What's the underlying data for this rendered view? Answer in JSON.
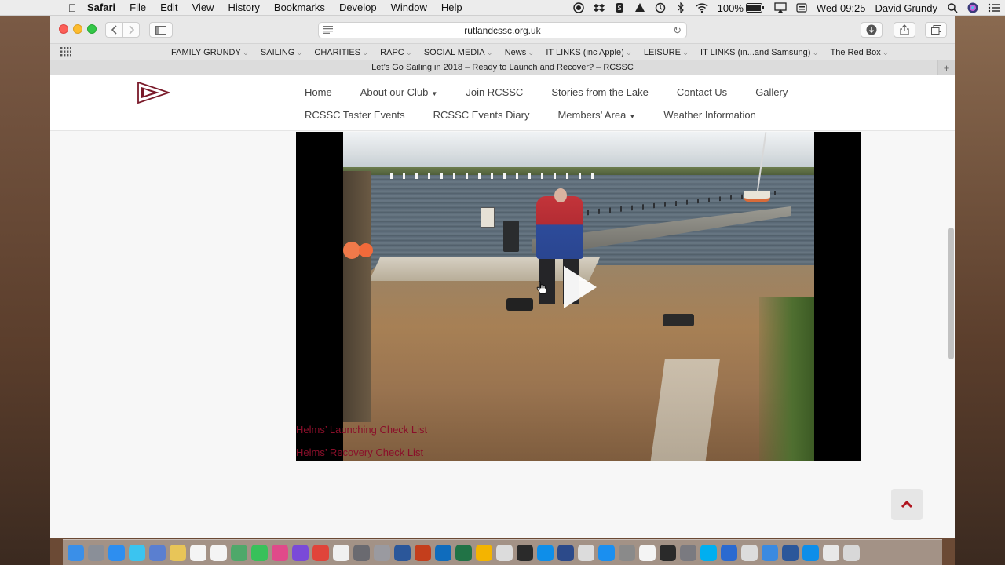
{
  "menubar": {
    "app_name": "Safari",
    "menus": [
      "File",
      "Edit",
      "View",
      "History",
      "Bookmarks",
      "Develop",
      "Window",
      "Help"
    ],
    "battery": "100%",
    "clock": "Wed 09:25",
    "user": "David Grundy"
  },
  "toolbar": {
    "url": "rutlandcssc.org.uk"
  },
  "favorites": [
    {
      "label": "FAMILY GRUNDY"
    },
    {
      "label": "SAILING"
    },
    {
      "label": "CHARITIES"
    },
    {
      "label": "RAPC"
    },
    {
      "label": "SOCIAL MEDIA"
    },
    {
      "label": "News"
    },
    {
      "label": "IT LINKS (inc Apple)"
    },
    {
      "label": "LEISURE"
    },
    {
      "label": "IT LINKS (in...and Samsung)"
    },
    {
      "label": "The Red Box"
    }
  ],
  "tab": {
    "title": "Let’s Go Sailing in 2018 – Ready to Launch and Recover? – RCSSC"
  },
  "site_nav": {
    "row1": [
      {
        "label": "Home",
        "dropdown": false
      },
      {
        "label": "About our Club",
        "dropdown": true
      },
      {
        "label": "Join RCSSC",
        "dropdown": false
      },
      {
        "label": "Stories from the Lake",
        "dropdown": false
      },
      {
        "label": "Contact Us",
        "dropdown": false
      },
      {
        "label": "Gallery",
        "dropdown": false
      }
    ],
    "row2": [
      {
        "label": "RCSSC Taster Events",
        "dropdown": false
      },
      {
        "label": "RCSSC Events Diary",
        "dropdown": false
      },
      {
        "label": "Members’ Area",
        "dropdown": true
      },
      {
        "label": "Weather Information",
        "dropdown": false
      }
    ]
  },
  "content": {
    "links": [
      "Helms’ Launching Check List",
      "Helms’ Recovery Check List"
    ]
  },
  "colors": {
    "link": "#8a0f2a",
    "to_top_arrow": "#b0151f"
  },
  "dock": {
    "icons": [
      "finder-icon",
      "launchpad-icon",
      "safari-icon",
      "ios-app-icon",
      "preview-icon",
      "notes-icon",
      "calendar-icon",
      "reminders-icon",
      "maps-icon",
      "messages-icon",
      "itunes-icon",
      "imovie-icon",
      "chrome-icon",
      "photos-icon",
      "image-capture-icon",
      "system-prefs-icon",
      "word-icon",
      "powerpoint-icon",
      "outlook-icon",
      "excel-icon",
      "google-drive-icon",
      "help-icon",
      "quicktime-icon",
      "teamviewer-icon",
      "malwarebytes-icon",
      "question-icon",
      "app-store-icon",
      "automator-icon",
      "textedit-icon",
      "mosaic-icon",
      "disk-utility-icon",
      "skype-icon",
      "wifi-icon",
      "help2-icon",
      "network-icon",
      "word-alt-icon",
      "teamviewer-alt-icon",
      "folder-icon",
      "trash-icon"
    ]
  }
}
